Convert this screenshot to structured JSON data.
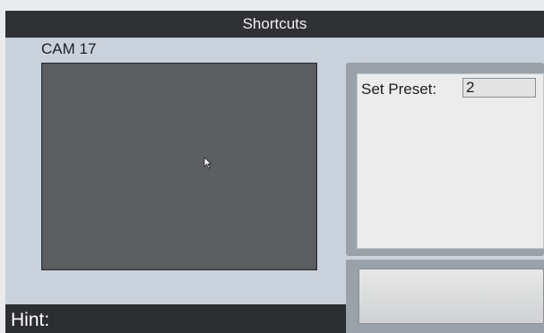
{
  "window": {
    "title": "Shortcuts"
  },
  "camera": {
    "label": "CAM 17"
  },
  "preset": {
    "label": "Set Preset:",
    "value": "2"
  },
  "hint": {
    "label": "Hint:"
  },
  "icons": {
    "cursor": "mouse-pointer-icon"
  },
  "colors": {
    "title_bar": "#2f3134",
    "window_bg": "#c9d2dc",
    "video_bg": "#5c5e62",
    "panel_bg": "#ececec"
  }
}
